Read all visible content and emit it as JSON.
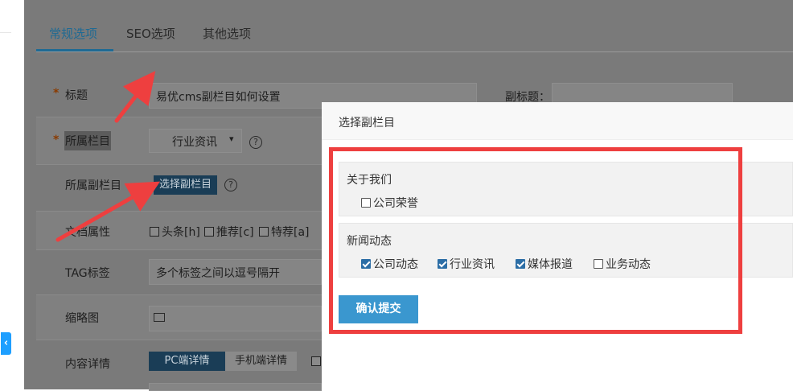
{
  "tabs": [
    {
      "label": "常规选项",
      "active": true
    },
    {
      "label": "SEO选项",
      "active": false
    },
    {
      "label": "其他选项",
      "active": false
    }
  ],
  "form": {
    "required_mark": "*",
    "title_label": "标题",
    "title_value": "易优cms副栏目如何设置",
    "subtitle_label": "副标题：",
    "column_label": "所属栏目",
    "column_value": "行业资讯",
    "subcolumn_label": "所属副栏目",
    "subcolumn_button": "选择副栏目",
    "help_glyph": "?",
    "attr_label": "文档属性",
    "attrs": [
      "头条[h]",
      "推荐[c]",
      "特荐[a]"
    ],
    "tag_label": "TAG标签",
    "tag_placeholder": "多个标签之间以逗号隔开",
    "thumb_label": "缩略图",
    "content_label": "内容详情",
    "content_tabs": [
      "PC端详情",
      "手机端详情"
    ]
  },
  "modal": {
    "title": "选择副栏目",
    "groups": [
      {
        "title": "关于我们",
        "options": [
          {
            "label": "公司荣誉",
            "checked": false
          }
        ]
      },
      {
        "title": "新闻动态",
        "options": [
          {
            "label": "公司动态",
            "checked": true
          },
          {
            "label": "行业资讯",
            "checked": true
          },
          {
            "label": "媒体报道",
            "checked": true
          },
          {
            "label": "业务动态",
            "checked": false
          }
        ]
      }
    ],
    "submit_label": "确认提交"
  },
  "colors": {
    "accent": "#3a97cf",
    "annotation": "#ee3f3f",
    "check": "#2c6ea6"
  },
  "icons": [
    "collapse-arrow-icon",
    "help-icon",
    "chevron-down-icon",
    "image-icon",
    "arrow-annotation-icon"
  ]
}
